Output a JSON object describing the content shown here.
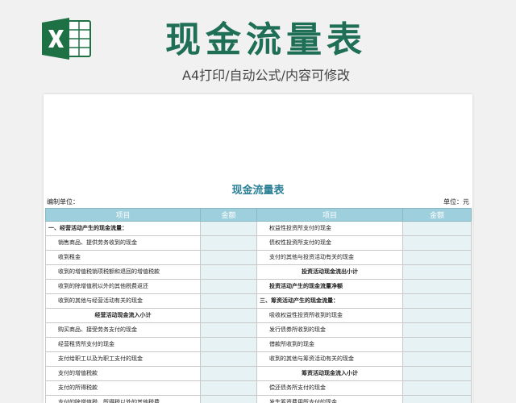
{
  "banner": {
    "title": "现金流量表",
    "subtitle": "A4打印/自动公式/内容可修改",
    "logo_icon": "excel-logo-icon",
    "logo_color": "#1e7145"
  },
  "sheet": {
    "title": "现金流量表",
    "prepared_by_label": "编制单位：",
    "unit_label": "单位：元",
    "headers": [
      "项目",
      "金额",
      "项目",
      "金额"
    ],
    "rows": [
      {
        "left": "一、经营活动产生的现金流量：",
        "right": "权益性投资所支付的现金"
      },
      {
        "left": "销售商品、提供劳务收到的现金",
        "right": "债权性投资所支付的现金"
      },
      {
        "left": "收到租金",
        "right": "支付的其他与投资活动有关的现金"
      },
      {
        "left": "收到的增值税销项税额和退回的增值税款",
        "right": "投资活动现金流出小计"
      },
      {
        "left": "收到的除增值税以外的其他税费返还",
        "right": "投资活动产生的现金流量净额"
      },
      {
        "left": "收到的其他与经营活动有关的现金",
        "right": "三、筹资活动产生的现金流量："
      },
      {
        "left": "经营活动现金流入小计",
        "right": "吸收权益性投资所收到的现金"
      },
      {
        "left": "购买商品、接受劳务支付的现金",
        "right": "发行债券所收到的现金"
      },
      {
        "left": "经营租赁所支付的现金",
        "right": "借款所收到的现金"
      },
      {
        "left": "支付给职工以及为职工支付的现金",
        "right": "收到的其他与筹资活动有关的现金"
      },
      {
        "left": "支付的增值税款",
        "right": "筹资活动现金流入小计"
      },
      {
        "left": "支付的所得税款",
        "right": "偿还债务所支付的现金"
      },
      {
        "left": "支付的除增值税、所得税以外的其他税费",
        "right": "发生筹资费用所支付的现金"
      }
    ]
  }
}
